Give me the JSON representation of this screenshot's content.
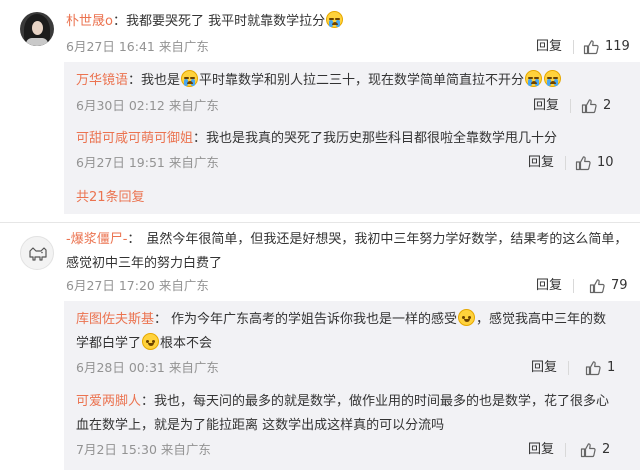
{
  "comments": [
    {
      "author": "朴世晟o",
      "text_before_emoji": "我都要哭死了 我平时就靠数学拉分",
      "time": "6月27日 16:41 来自广东",
      "reply_label": "回复",
      "likes": "119",
      "sub_replies": [
        {
          "author": "万华镜语",
          "text_a": "我也是",
          "text_b": "平时靠数学和别人拉二三十，现在数学简单简直拉不开分",
          "time": "6月30日 02:12 来自广东",
          "reply_label": "回复",
          "likes": "2"
        },
        {
          "author": "可甜可咸可萌可御姐",
          "text": "我也是我真的哭死了我历史那些科目都很啦全靠数学甩几十分",
          "time": "6月27日 19:51 来自广东",
          "reply_label": "回复",
          "likes": "10"
        }
      ],
      "more_replies": "共21条回复"
    },
    {
      "author": "-爆浆僵尸-",
      "text_line1": "虽然今年很简单，但我还是好想哭，我初中三年努力学好数学，结果考的这么简单，",
      "text_line2": "感觉初中三年的努力白费了",
      "time": "6月27日 17:20 来自广东",
      "reply_label": "回复",
      "likes": "79",
      "sub_replies": [
        {
          "author": "库图佐夫斯基",
          "text_line1": "作为今年广东高考的学姐告诉你我也是一样的感受",
          "text_line1_after": "，感觉我高中三年的数",
          "text_line2_a": "学都白学了",
          "text_line2_b": "根本不会",
          "time": "6月28日 00:31 来自广东",
          "reply_label": "回复",
          "likes": "1"
        },
        {
          "author": "可爱两脚人",
          "text_line1": "我也，每天问的最多的就是数学，做作业用的时间最多的也是数学，花了很多心",
          "text_line2": "血在数学上，就是为了能拉距离 这数学出成这样真的可以分流吗",
          "time": "7月2日 15:30 来自广东",
          "reply_label": "回复",
          "likes": "2"
        }
      ]
    }
  ],
  "colors": {
    "accent": "#eb7350",
    "meta": "#939393",
    "subbox": "#f2f2f5"
  },
  "icons": {
    "like": "thumbs-up-icon",
    "emoji_cry": "crying-face-emoji",
    "emoji_smile": "smiling-face-emoji"
  }
}
